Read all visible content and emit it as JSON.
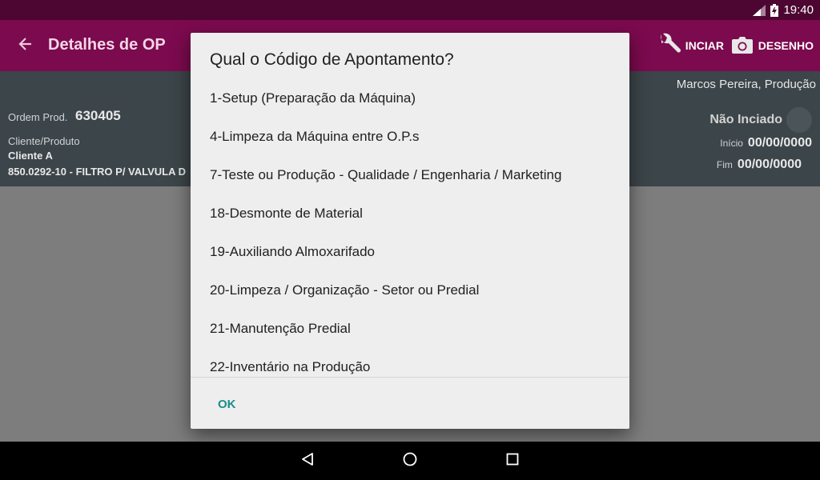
{
  "status_bar": {
    "time": "19:40"
  },
  "app_bar": {
    "title": "Detalhes de OP",
    "start_label": "INCIAR",
    "drawing_label": "DESENHO",
    "colors": {
      "bar": "#7c0a4e",
      "status": "#4d0632"
    }
  },
  "info": {
    "user": "Marcos Pereira, Produção",
    "op_label": "Ordem Prod.",
    "op_number": "630405",
    "client_product_label": "Cliente/Produto",
    "client": "Cliente A",
    "product": "850.0292-10 - FILTRO P/ VALVULA D",
    "status": "Não Inciado",
    "start_label": "Início",
    "start_date": "00/00/0000",
    "end_label": "Fim",
    "end_date": "00/00/0000"
  },
  "dialog": {
    "title": "Qual o Código de Apontamento?",
    "options": [
      "1-Setup (Preparação da Máquina)",
      "4-Limpeza da Máquina entre O.P.s",
      "7-Teste ou Produção - Qualidade / Engenharia / Marketing",
      "18-Desmonte de Material",
      "19-Auxiliando Almoxarifado",
      "20-Limpeza / Organização - Setor ou Predial",
      "21-Manutenção Predial",
      "22-Inventário na Produção"
    ],
    "ok_label": "OK",
    "accent": "#1a8e86"
  },
  "icons": {
    "back": "arrow-left-icon",
    "start": "wrench-icon",
    "drawing": "camera-icon",
    "nav": [
      "triangle-back-icon",
      "circle-home-icon",
      "square-recent-icon"
    ]
  }
}
